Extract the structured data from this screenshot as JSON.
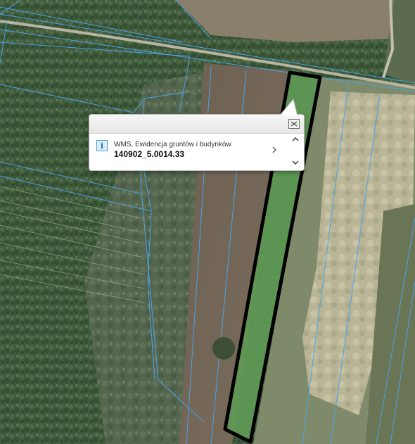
{
  "map": {
    "basemap": "orthophoto",
    "parcel_boundary_color": "#4aa3e8",
    "selected_parcel_fill": "#5f9a55",
    "selected_parcel_outline": "#000000"
  },
  "popup": {
    "close_icon": "close-icon",
    "info_icon": "info-icon",
    "info_glyph": "i",
    "layer_name": "WMS, Ewidencja gruntów i budynków",
    "parcel_id": "140902_5.0014.33",
    "next_icon": "chevron-right-icon",
    "scroll_up_icon": "chevron-up-icon",
    "scroll_down_icon": "chevron-down-icon"
  }
}
